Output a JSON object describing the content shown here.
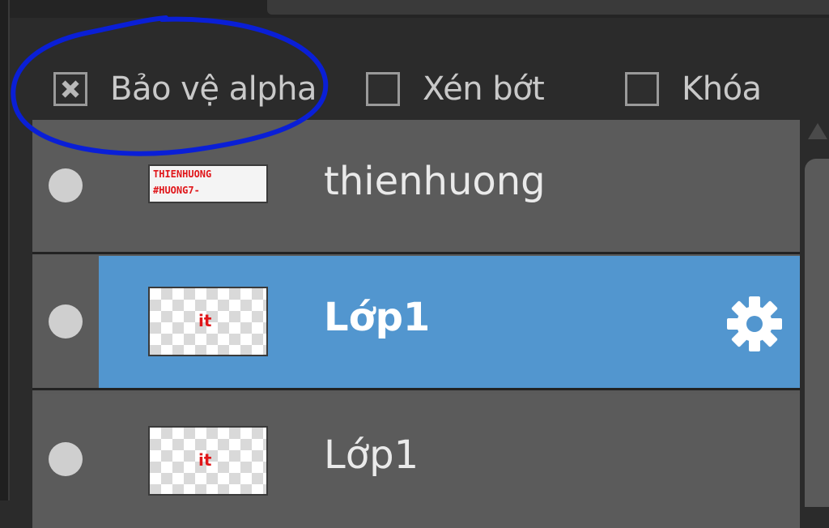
{
  "options": [
    {
      "label": "Bảo vệ alpha",
      "checked": true
    },
    {
      "label": "Xén bớt",
      "checked": false
    },
    {
      "label": "Khóa",
      "checked": false
    }
  ],
  "annotation": {
    "color": "#0a1fd6"
  },
  "layers": [
    {
      "name": "thienhuong",
      "thumb_text": [
        "THIENHUONG",
        "#HUONG7-"
      ],
      "selected": false
    },
    {
      "name": "Lớp1",
      "thumb_text": "it",
      "selected": true
    },
    {
      "name": "Lớp1",
      "thumb_text": "it",
      "selected": false
    }
  ],
  "icons": {
    "settings": "gear-icon",
    "visibility": "visibility-toggle-icon"
  },
  "colors": {
    "selected": "#5296cf",
    "row": "#5b5b5b",
    "panel": "#2b2b2b"
  }
}
